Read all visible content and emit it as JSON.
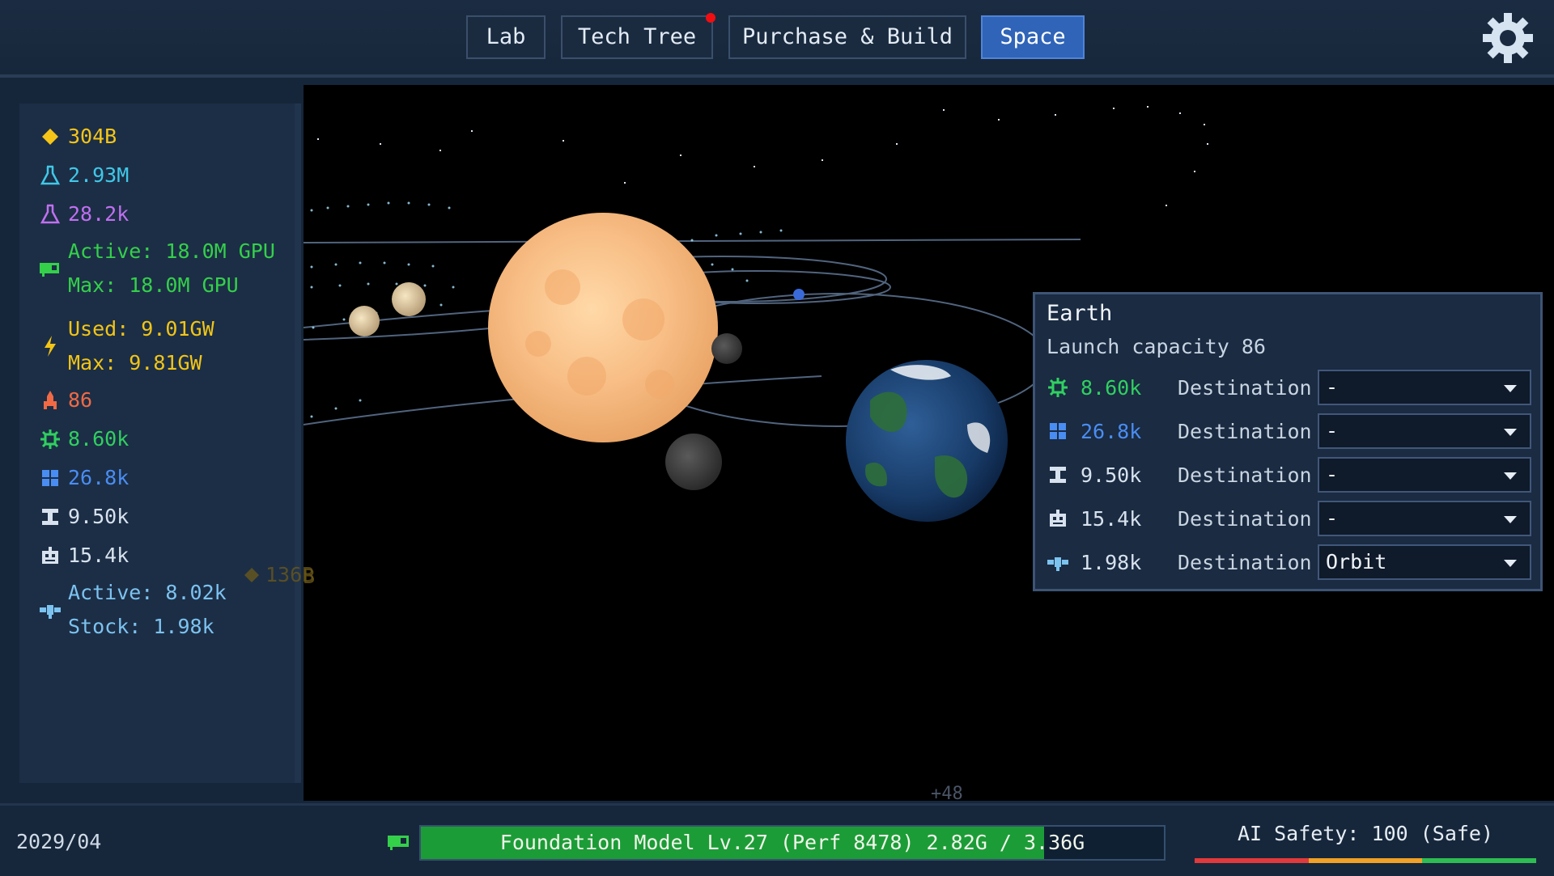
{
  "nav": {
    "tabs": [
      {
        "label": "Lab"
      },
      {
        "label": "Tech Tree",
        "has_notification": true
      },
      {
        "label": "Purchase & Build"
      },
      {
        "label": "Space",
        "active": true
      }
    ]
  },
  "resources": {
    "money": "304B",
    "research_cyan": "2.93M",
    "research_purple": "28.2k",
    "gpu_active": "Active: 18.0M GPU",
    "gpu_max": "Max: 18.0M GPU",
    "power_used": "Used: 9.01GW",
    "power_max": "Max: 9.81GW",
    "rockets": "86",
    "chips": "8.60k",
    "panels": "26.8k",
    "beams": "9.50k",
    "robots": "15.4k",
    "satellites_active": "Active: 8.02k",
    "satellites_stock": "Stock: 1.98k"
  },
  "space": {
    "floating_money": "136B",
    "floating_increment": "+48"
  },
  "popup": {
    "title": "Earth",
    "subtitle": "Launch capacity 86",
    "dest_label": "Destination",
    "rows": [
      {
        "icon": "chip-icon",
        "value": "8.60k",
        "destination": "-"
      },
      {
        "icon": "panel-icon",
        "value": "26.8k",
        "destination": "-"
      },
      {
        "icon": "beam-icon",
        "value": "9.50k",
        "destination": "-"
      },
      {
        "icon": "robot-icon",
        "value": "15.4k",
        "destination": "-"
      },
      {
        "icon": "satellite-icon",
        "value": "1.98k",
        "destination": "Orbit"
      }
    ]
  },
  "bottom": {
    "date": "2029/04",
    "progress_text": "Foundation Model Lv.27 (Perf 8478) 2.82G / 3.36G",
    "progress_fraction": 0.839,
    "safety_text": "AI Safety: 100 (Safe)"
  },
  "colors": {
    "money": "#f5c518",
    "research_cyan": "#40c8e8",
    "research_purple": "#c070f0",
    "gpu": "#34d04a",
    "power": "#f2c516",
    "rocket": "#ef6a45",
    "chip": "#30d060",
    "panel": "#4a8df2",
    "text_light": "#d8e2ee",
    "active_tab": "#2f64b8",
    "progress_fill": "#1c9c37"
  }
}
